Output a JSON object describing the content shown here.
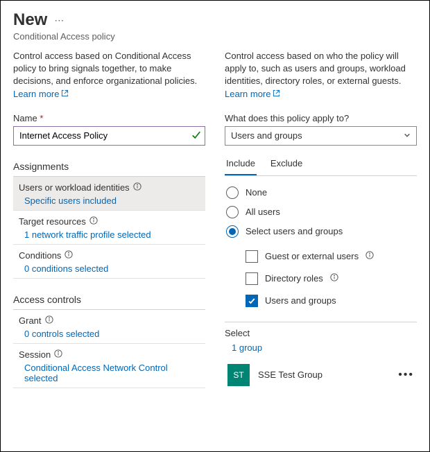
{
  "header": {
    "title": "New",
    "subtitle": "Conditional Access policy"
  },
  "left": {
    "desc": "Control access based on Conditional Access policy to bring signals together, to make decisions, and enforce organizational policies.",
    "learn_more": "Learn more",
    "name_label": "Name",
    "name_value": "Internet Access Policy",
    "assignments_heading": "Assignments",
    "users_identities": {
      "title": "Users or workload identities",
      "sub": "Specific users included"
    },
    "target_resources": {
      "title": "Target resources",
      "sub": "1 network traffic profile selected"
    },
    "conditions": {
      "title": "Conditions",
      "sub": "0 conditions selected"
    },
    "access_controls_heading": "Access controls",
    "grant": {
      "title": "Grant",
      "sub": "0 controls selected"
    },
    "session": {
      "title": "Session",
      "sub": "Conditional Access Network Control selected"
    }
  },
  "right": {
    "desc": "Control access based on who the policy will apply to, such as users and groups, workload identities, directory roles, or external guests.",
    "learn_more": "Learn more",
    "applies_to_label": "What does this policy apply to?",
    "applies_to_value": "Users and groups",
    "tabs": {
      "include": "Include",
      "exclude": "Exclude"
    },
    "radios": {
      "none": "None",
      "all_users": "All users",
      "select_users": "Select users and groups"
    },
    "checks": {
      "guest": "Guest or external users",
      "directory_roles": "Directory roles",
      "users_groups": "Users and groups"
    },
    "select_label": "Select",
    "select_link": "1 group",
    "group": {
      "initials": "ST",
      "name": "SSE Test Group"
    }
  }
}
